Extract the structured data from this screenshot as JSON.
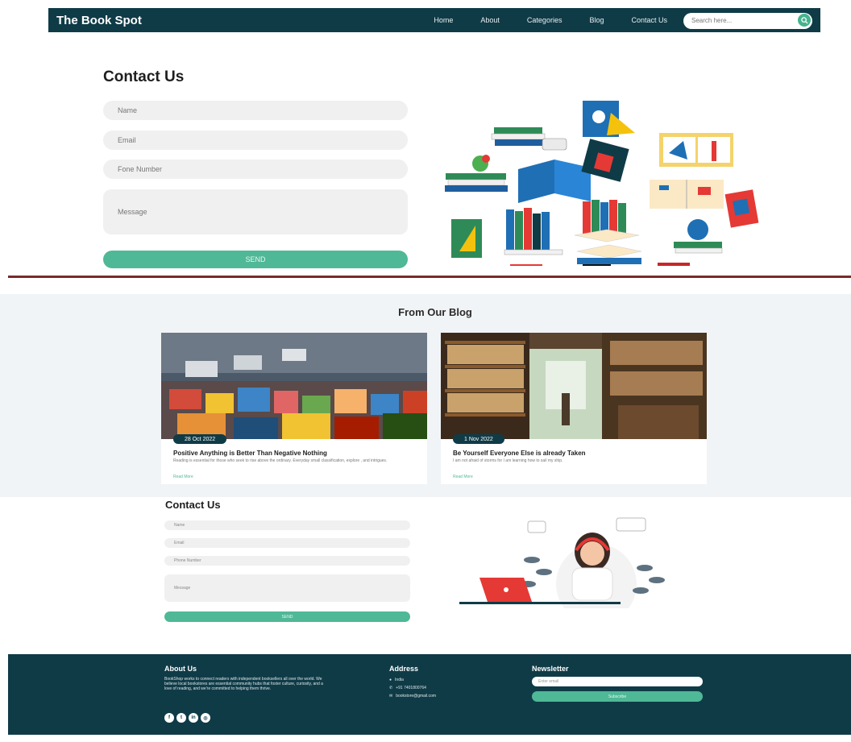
{
  "navbar": {
    "brand": "The Book Spot",
    "links": [
      "Home",
      "About",
      "Categories",
      "Blog",
      "Contact Us"
    ],
    "search_placeholder": "Search here..."
  },
  "contact_primary": {
    "title": "Contact Us",
    "fields": [
      "Name",
      "Email",
      "Fone Number",
      "Message"
    ],
    "send_label": "SEND"
  },
  "blog": {
    "title": "From Our Blog",
    "posts": [
      {
        "date": "28 Oct 2022",
        "title": "Positive Anything is Better Than Negative Nothing",
        "text": "Reading is essential for those who seek to rise above the ordinary. Everyday small classification, explore , and intrigues.",
        "link": "Read More"
      },
      {
        "date": "1 Nov 2022",
        "title": "Be Yourself Everyone Else is already Taken",
        "text": "I am not afraid of storms for I am learning how to sail my ship.",
        "link": "Read More"
      }
    ]
  },
  "contact_secondary": {
    "title": "Contact Us",
    "fields": [
      "Name",
      "Email",
      "Phone Number",
      "Message"
    ],
    "send_label": "SEND"
  },
  "footer": {
    "about_title": "About Us",
    "about_text": "BookShop works to connect readers with independent booksellers all over the world. We believe local bookstores are essential community hubs that foster culture, curiosity, and a love of reading, and we're committed to helping them thrive.",
    "address_title": "Address",
    "address_lines": [
      "India",
      "+91 7401800764",
      "bookstore@gmail.com"
    ],
    "newsletter_title": "Newsletter",
    "newsletter_placeholder": "Enter email",
    "subscribe_label": "Subscribe"
  },
  "colors": {
    "dark_teal": "#0f3b47",
    "accent_green": "#4fb896",
    "rule_red": "#7a2a2a"
  }
}
